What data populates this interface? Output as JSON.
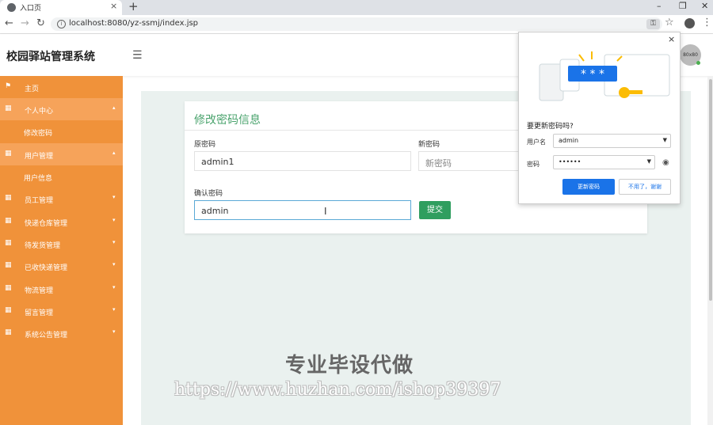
{
  "browser": {
    "tab_title": "入口页",
    "address": "localhost:8080/yz-ssmj/index.jsp",
    "win_min": "–",
    "win_max": "❐",
    "win_close": "✕",
    "tab_close": "×",
    "new_tab": "+"
  },
  "header": {
    "app_title": "校园驿站管理系统",
    "avatar_text": "80x80"
  },
  "sidebar": {
    "items": [
      {
        "label": "主页",
        "icon": "flag-icon"
      },
      {
        "label": "个人中心",
        "icon": "grid-icon",
        "expanded": true
      },
      {
        "label": "修改密码",
        "sub": true
      },
      {
        "label": "用户管理",
        "icon": "grid-icon",
        "expanded": true
      },
      {
        "label": "用户信息",
        "sub": true
      },
      {
        "label": "员工管理",
        "icon": "grid-icon"
      },
      {
        "label": "快递仓库管理",
        "icon": "grid-icon"
      },
      {
        "label": "待发货管理",
        "icon": "grid-icon"
      },
      {
        "label": "已收快递管理",
        "icon": "grid-icon"
      },
      {
        "label": "物流管理",
        "icon": "grid-icon"
      },
      {
        "label": "留言管理",
        "icon": "grid-icon"
      },
      {
        "label": "系统公告管理",
        "icon": "grid-icon"
      }
    ]
  },
  "form": {
    "title": "修改密码信息",
    "old_password_label": "原密码",
    "old_password_value": "admin1",
    "new_password_label": "新密码",
    "new_password_placeholder": "新密码",
    "confirm_password_label": "确认密码",
    "confirm_password_value": "admin",
    "submit_label": "提交"
  },
  "watermark": {
    "title": "专业毕设代做",
    "url": "https://www.huzhan.com/ishop39397"
  },
  "password_popup": {
    "title": "要更新密码吗?",
    "username_label": "用户名",
    "username_value": "admin",
    "password_label": "密码",
    "password_value": "••••••",
    "update_button": "更新密码",
    "decline_button": "不用了，谢谢",
    "close": "×",
    "illustration_text": "* * *"
  }
}
